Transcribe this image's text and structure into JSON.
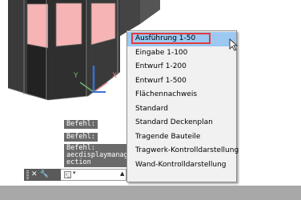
{
  "menu": {
    "items": [
      {
        "label": "Ausführung 1-50"
      },
      {
        "label": "Eingabe 1-100"
      },
      {
        "label": "Entwurf 1-200"
      },
      {
        "label": "Entwurf 1-500"
      },
      {
        "label": "Flächennachweis"
      },
      {
        "label": "Standard"
      },
      {
        "label": "Standard Deckenplan"
      },
      {
        "label": "Tragende Bauteile"
      },
      {
        "label": "Tragwerk-Kontrolldarstellung"
      },
      {
        "label": "Wand-Kontrolldarstellung"
      }
    ],
    "selected_index": 0
  },
  "command_line": {
    "history": [
      "Befehl:",
      "Befehl:"
    ],
    "current_lines": [
      "Befehl:",
      "aecdisplaymanag",
      "ection"
    ],
    "input_value": "",
    "icons": [
      "close-icon",
      "wrench-icon",
      "command-prompt-icon",
      "dropdown-arrow-icon"
    ]
  },
  "viewport": {
    "axis_labels": [
      "Y",
      "X"
    ],
    "colors": {
      "wall": "#f6b4b4",
      "dark_block": "#3a3a3a",
      "axis_y": "#74b574",
      "axis_x": "#e08080",
      "axis_z": "#3a6fd0",
      "accent_selected": "#9cc8f2",
      "highlight_border": "#e33b3b"
    }
  }
}
